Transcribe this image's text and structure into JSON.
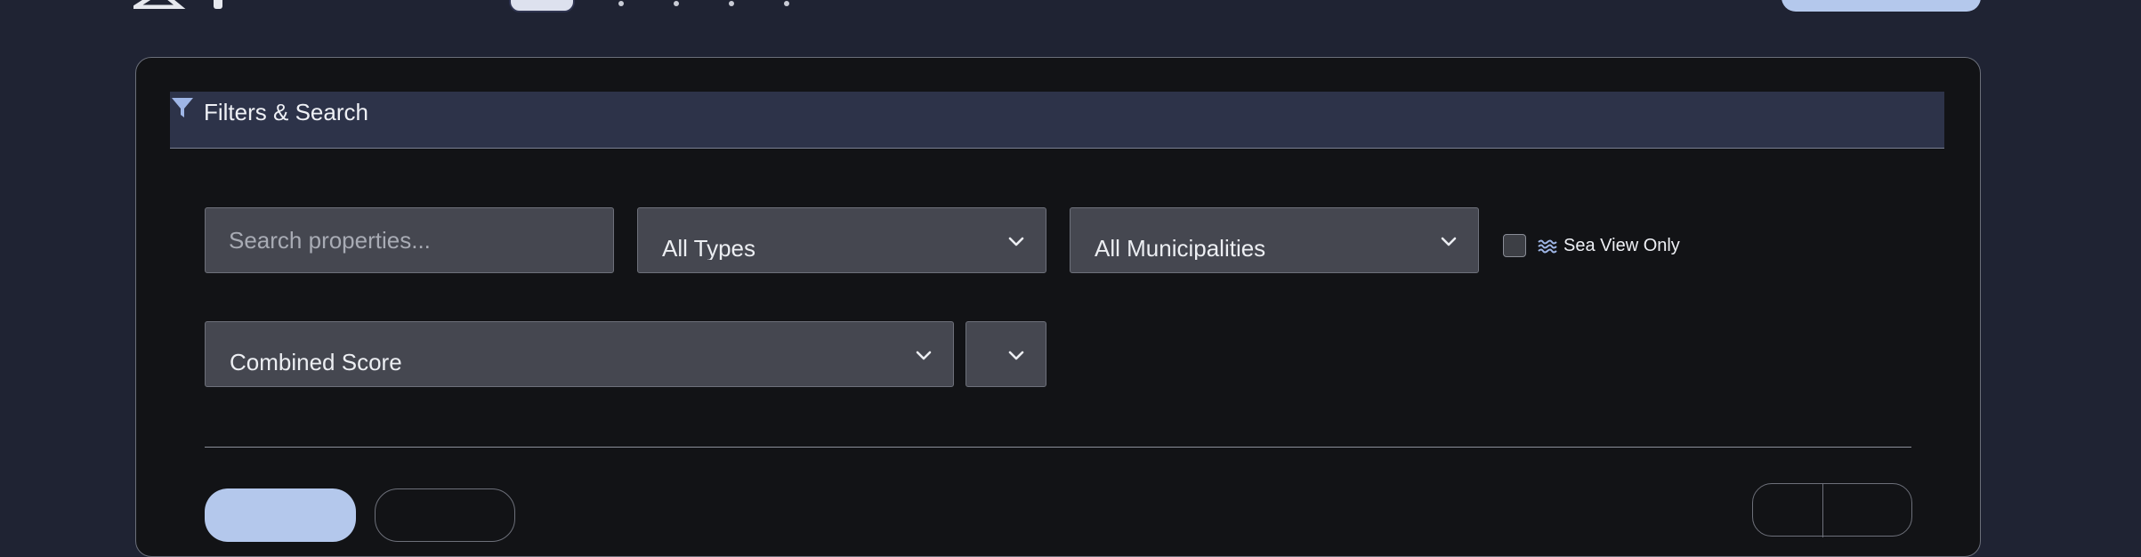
{
  "card": {
    "title": "Filters & Search",
    "icon": "filter-icon"
  },
  "filters": {
    "search_placeholder": "Search properties...",
    "search_value": "",
    "type_select": "All Types",
    "municipality_select": "All Municipalities",
    "sea_view_label": "Sea View Only",
    "sea_view_checked": false,
    "sea_view_icon": "waves-icon",
    "sort_select": "Combined Score"
  },
  "colors": {
    "page_bg": "#1f2333",
    "card_bg": "#121316",
    "header_bg": "#2d3349",
    "field_bg": "#454750",
    "accent": "#b4c8ec"
  }
}
